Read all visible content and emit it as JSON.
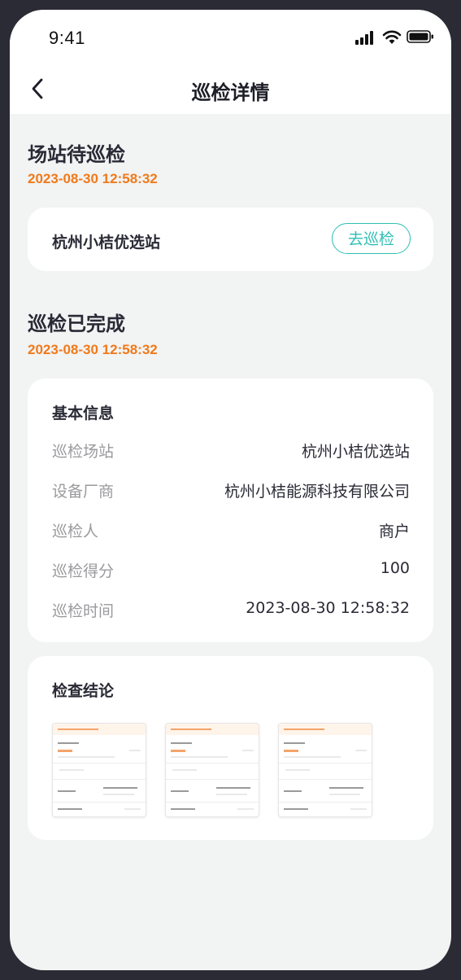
{
  "status_bar": {
    "time": "9:41",
    "icons": [
      "signal-icon",
      "wifi-icon",
      "battery-icon"
    ]
  },
  "navbar": {
    "title": "巡检详情",
    "back_icon": "chevron-left-icon"
  },
  "pending": {
    "title": "场站待巡检",
    "time": "2023-08-30 12:58:32",
    "station_name": "杭州小桔优选站",
    "action_label": "去巡检"
  },
  "completed": {
    "title": "巡检已完成",
    "time": "2023-08-30 12:58:32"
  },
  "basic_info": {
    "heading": "基本信息",
    "rows": [
      {
        "label": "巡检场站",
        "value": "杭州小桔优选站"
      },
      {
        "label": "设备厂商",
        "value": "杭州小桔能源科技有限公司"
      },
      {
        "label": "巡检人",
        "value": "商户"
      },
      {
        "label": "巡检得分",
        "value": "100"
      },
      {
        "label": "巡检时间",
        "value": "2023-08-30 12:58:32"
      }
    ]
  },
  "conclusion": {
    "heading": "检查结论",
    "images": [
      "photo-thumbnail",
      "photo-thumbnail",
      "photo-thumbnail"
    ]
  },
  "colors": {
    "accent_teal": "#2dbfb4",
    "time_orange": "#f07a1a",
    "background": "#f2f3f3"
  }
}
